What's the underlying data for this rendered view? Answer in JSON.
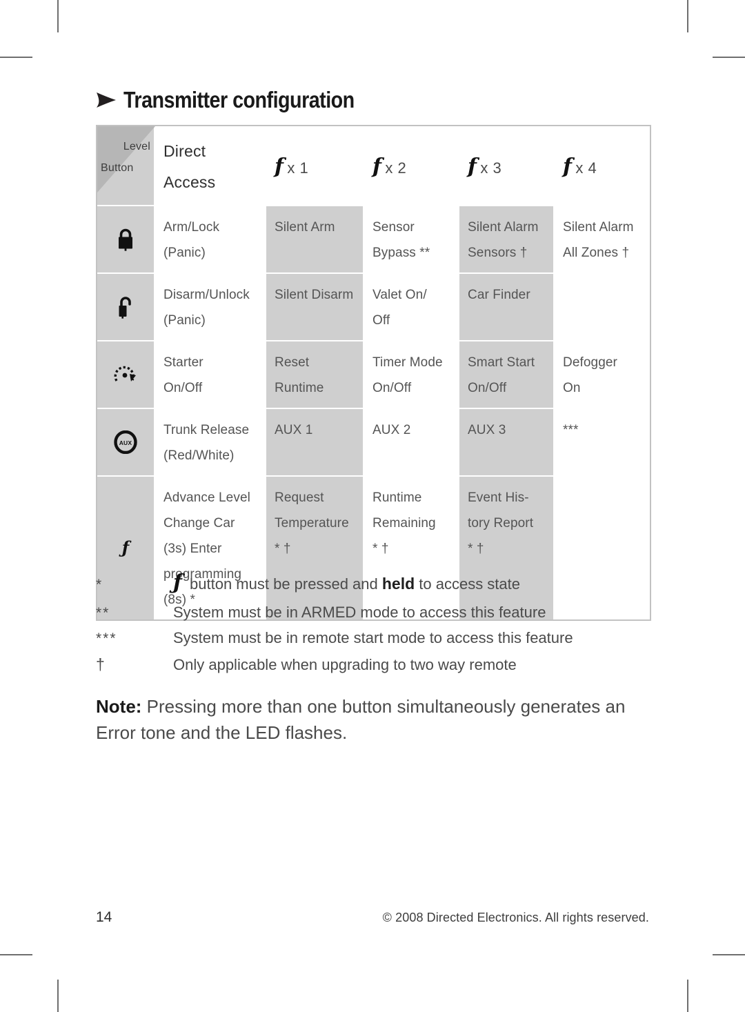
{
  "heading": {
    "arrow_icon": "right-triangle-arrow-icon",
    "title": "Transmitter configuration"
  },
  "table": {
    "corner": {
      "level_label": "Level",
      "button_label": "Button"
    },
    "columns": [
      {
        "key": "icon",
        "label": ""
      },
      {
        "key": "direct",
        "label": "Direct Access"
      },
      {
        "key": "f1",
        "label": "x 1",
        "glyph": "f"
      },
      {
        "key": "f2",
        "label": "x 2",
        "glyph": "f"
      },
      {
        "key": "f3",
        "label": "x 3",
        "glyph": "f"
      },
      {
        "key": "f4",
        "label": "x 4",
        "glyph": "f"
      }
    ],
    "rows": [
      {
        "icon": "lock-closed-icon",
        "direct": [
          "Arm/Lock",
          "(Panic)"
        ],
        "f1": [
          "Silent Arm"
        ],
        "f2": [
          "Sensor",
          "Bypass **"
        ],
        "f3": [
          "Silent Alarm",
          "Sensors †"
        ],
        "f4": [
          "Silent Alarm",
          "All Zones †"
        ]
      },
      {
        "icon": "lock-open-icon",
        "direct": [
          "Disarm/Unlock",
          "(Panic)"
        ],
        "f1": [
          "Silent Disarm"
        ],
        "f2": [
          "Valet On/",
          "Off"
        ],
        "f3": [
          "Car Finder"
        ],
        "f4": []
      },
      {
        "icon": "ignition-start-icon",
        "direct": [
          "Starter",
          "On/Off"
        ],
        "f1": [
          "Reset",
          "Runtime"
        ],
        "f2": [
          "Timer Mode",
          "On/Off"
        ],
        "f3": [
          "Smart Start",
          "On/Off"
        ],
        "f4": [
          "Defogger",
          "On"
        ]
      },
      {
        "icon": "aux-circle-icon",
        "direct": [
          "Trunk Release",
          "(Red/White)"
        ],
        "f1": [
          "AUX 1"
        ],
        "f2": [
          "AUX 2"
        ],
        "f3": [
          "AUX 3"
        ],
        "f4": [
          "***"
        ]
      },
      {
        "icon": "f-button-icon",
        "direct": [
          "Advance Level",
          "Change Car",
          "(3s) Enter",
          "programming",
          "(8s) *"
        ],
        "f1": [
          "Request",
          "Temperature",
          "* †"
        ],
        "f2": [
          "Runtime",
          "Remaining",
          "* †"
        ],
        "f3": [
          "Event His-",
          "tory Report",
          "* †"
        ],
        "f4": []
      }
    ]
  },
  "footnotes": [
    {
      "mark": "*",
      "text_before": " button must be pressed and ",
      "bold": "held",
      "text_after": " to access state",
      "has_glyph": true
    },
    {
      "mark": "**",
      "text": "System must be in ARMED mode to access this feature"
    },
    {
      "mark": "***",
      "text": "System must be in remote start mode to access this feature"
    },
    {
      "mark": "†",
      "text": "Only applicable when upgrading to two way remote"
    }
  ],
  "note": {
    "label": "Note:",
    "text": " Pressing more than one button simultaneously generates an Error tone and the LED flashes."
  },
  "footer": {
    "page_number": "14",
    "copyright": "© 2008 Directed Electronics. All rights reserved."
  },
  "colors": {
    "shade": "#cfcfcf",
    "border": "#c2c2c2",
    "text": "#545454",
    "heading": "#1a1a1a"
  }
}
